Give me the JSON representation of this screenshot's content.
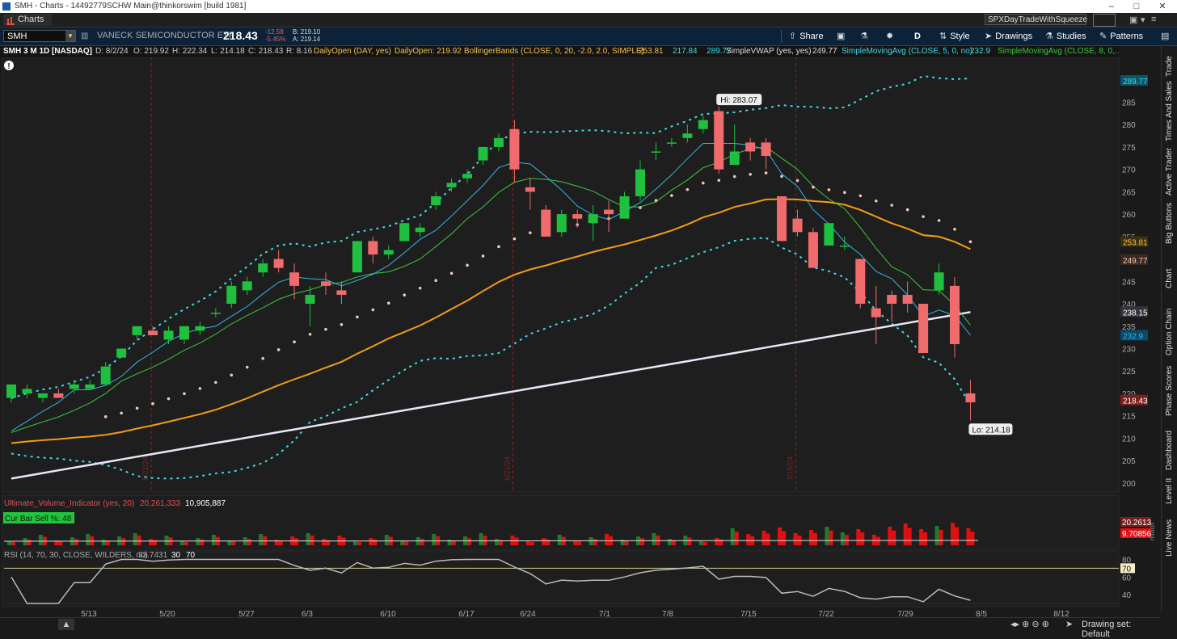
{
  "window": {
    "title": "SMH - Charts - 14492779SCHW Main@thinkorswim [build 1981]",
    "min": "–",
    "max": "□",
    "close": "✕"
  },
  "tabs": {
    "active": "Charts",
    "preset": "SPXDayTradeWithSqueeze"
  },
  "toolbar": {
    "symbol": "SMH",
    "description": "VANECK SEMICONDUCTOR ETF",
    "last": "218.43",
    "change": "-12.58",
    "change_pct": "-5.45%",
    "bid": "B: 219.10",
    "ask": "A: 219.14",
    "share": "Share",
    "aggregation": "D",
    "style": "Style",
    "drawings": "Drawings",
    "studies": "Studies",
    "patterns": "Patterns"
  },
  "studybar": {
    "header": "SMH 3 M 1D [NASDAQ]",
    "date": "D: 8/2/24",
    "open": "O: 219.92",
    "high": "H: 222.34",
    "low": "L: 214.18",
    "close": "C: 218.43",
    "range": "R: 8.16",
    "daily_open_1": "DailyOpen (DAY, yes)",
    "daily_open_2": "DailyOpen: 219.92",
    "bb": "BollingerBands (CLOSE, 0, 20, -2.0, 2.0, SIMPLE)",
    "bb_v1": "253.81",
    "bb_v2": "217.84",
    "bb_v3": "289.77",
    "vwap": "SimpleVWAP (yes, yes)",
    "vwap_v": "249.77",
    "sma5": "SimpleMovingAvg (CLOSE, 5, 0, no)",
    "sma5_v": "232.9",
    "sma8": "SimpleMovingAvg (CLOSE, 8, 0,..."
  },
  "colors": {
    "up": "#1fbf3f",
    "down": "#f06b6b",
    "bb": "#3fd8e8",
    "sma200": "#e8e8f8",
    "orange": "#f39c12",
    "vline": "#8b2020"
  },
  "chart_data": {
    "type": "candlestick",
    "x_labels": [
      "5/13",
      "5/20",
      "5/27",
      "6/3",
      "6/10",
      "6/17",
      "6/24",
      "7/1",
      "7/8",
      "7/15",
      "7/22",
      "7/29",
      "8/5",
      "8/12"
    ],
    "y_ticks": [
      200,
      205,
      210,
      215,
      220,
      225,
      230,
      235,
      240,
      245,
      250,
      255,
      260,
      265,
      270,
      275,
      280,
      285
    ],
    "ylim": [
      198,
      295
    ],
    "high_label": "Hi: 283.07",
    "low_label": "Lo: 214.18",
    "vline_labels": [
      "5/21/24",
      "6/21/24",
      "7/19/24"
    ],
    "candles": [
      [
        219,
        222,
        218,
        222
      ],
      [
        220,
        222,
        219,
        221
      ],
      [
        219,
        220,
        218,
        220
      ],
      [
        220,
        221,
        219,
        219
      ],
      [
        221,
        223,
        220,
        222
      ],
      [
        221,
        223,
        221,
        222
      ],
      [
        222,
        227,
        222,
        226
      ],
      [
        228,
        230,
        228,
        230
      ],
      [
        233,
        235,
        232,
        235
      ],
      [
        234,
        235,
        233,
        233
      ],
      [
        232,
        235,
        231,
        234
      ],
      [
        232,
        235,
        231,
        235
      ],
      [
        234,
        236,
        233,
        235
      ],
      [
        238,
        239,
        237,
        238
      ],
      [
        240,
        245,
        239,
        244
      ],
      [
        243,
        246,
        242,
        245
      ],
      [
        247,
        250,
        246,
        249
      ],
      [
        250,
        252,
        247,
        248
      ],
      [
        247,
        249,
        241,
        244
      ],
      [
        240,
        244,
        235,
        242
      ],
      [
        245,
        247,
        242,
        244
      ],
      [
        243,
        245,
        240,
        242
      ],
      [
        247,
        254,
        247,
        254
      ],
      [
        254,
        255,
        249,
        251
      ],
      [
        251,
        253,
        250,
        252
      ],
      [
        254,
        258,
        254,
        258
      ],
      [
        256,
        258,
        255,
        257
      ],
      [
        262,
        265,
        261,
        264
      ],
      [
        266,
        268,
        265,
        267
      ],
      [
        268,
        270,
        267,
        269
      ],
      [
        272,
        275,
        271,
        275
      ],
      [
        275,
        278,
        274,
        277
      ],
      [
        279,
        281,
        267,
        270
      ],
      [
        266,
        268,
        261,
        265
      ],
      [
        261,
        262,
        255,
        255
      ],
      [
        256,
        261,
        255,
        260
      ],
      [
        260,
        261,
        257,
        259
      ],
      [
        258,
        262,
        254,
        260
      ],
      [
        261,
        263,
        256,
        260
      ],
      [
        259,
        265,
        259,
        264
      ],
      [
        264,
        272,
        263,
        270
      ],
      [
        274,
        276,
        272,
        274
      ],
      [
        276,
        277,
        275,
        276
      ],
      [
        277,
        280,
        276,
        278
      ],
      [
        279,
        282,
        278,
        281
      ],
      [
        283,
        284,
        269,
        270
      ],
      [
        271,
        280,
        271,
        274
      ],
      [
        276,
        277,
        272,
        274
      ],
      [
        276,
        277,
        270,
        273
      ],
      [
        264,
        264,
        254,
        254
      ],
      [
        259,
        261,
        255,
        256
      ],
      [
        256,
        257,
        248,
        248
      ],
      [
        253,
        258,
        253,
        258
      ],
      [
        253,
        255,
        252,
        253
      ],
      [
        250,
        250,
        239,
        240
      ],
      [
        239,
        244,
        231,
        237
      ],
      [
        242,
        243,
        236,
        240
      ],
      [
        242,
        245,
        238,
        240
      ],
      [
        240,
        240,
        229,
        229
      ],
      [
        243,
        249,
        242,
        247
      ],
      [
        244,
        246,
        228,
        231
      ],
      [
        220,
        223,
        214,
        218
      ]
    ],
    "bb_upper_last": "289.77",
    "bb_mid_last": "253.81",
    "vwap_last": "249.77",
    "sma200_last": "238.15",
    "sma5_last": "232.9",
    "close_last": "218.43",
    "volume": {
      "title": "Ultimate_Volume_Indicator (yes, 20)",
      "v1": "20,261,333",
      "v2": "10,905,887",
      "badge": "Cur Bar Sell %: 48",
      "right1": "20.2613",
      "right2": "9.70856",
      "unit": "million"
    },
    "rsi": {
      "title": "RSI (14, 70, 30, CLOSE, WILDERS, no)",
      "value": "33.7431",
      "ob": "30",
      "os": "70",
      "ticks": [
        40,
        60,
        80
      ],
      "level_label": "70"
    }
  },
  "sidebar": [
    "Trade",
    "Times And Sales",
    "Active Trader",
    "Big Buttons",
    "Chart",
    "Option Chain",
    "Phase Scores",
    "Dashboard",
    "Level II",
    "Live News"
  ],
  "status": {
    "drawing_set": "Drawing set: Default"
  }
}
